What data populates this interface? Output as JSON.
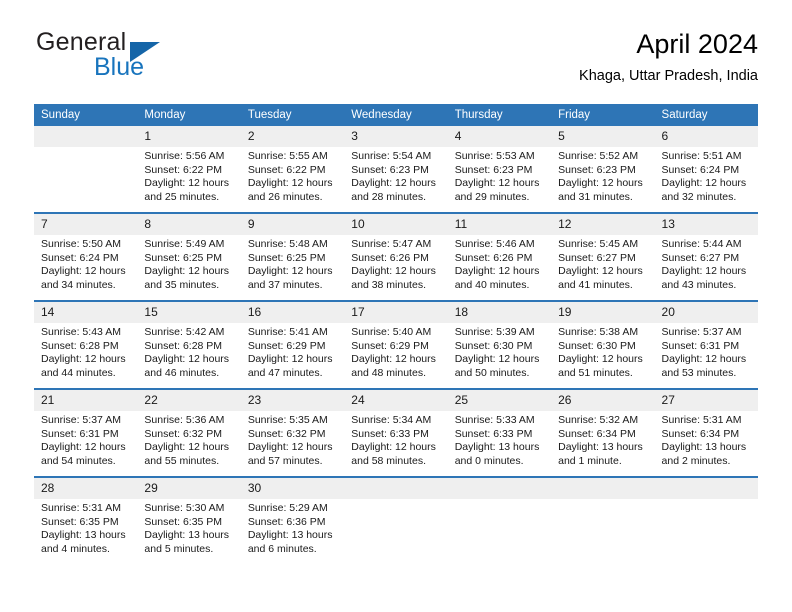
{
  "logo": {
    "word_top": "General",
    "word_bottom": "Blue",
    "triangle_color": "#1565a8",
    "blue_color": "#1874bd"
  },
  "header": {
    "title": "April 2024",
    "subtitle": "Khaga, Uttar Pradesh, India"
  },
  "theme": {
    "header_blue": "#2e75b6",
    "daynum_gray": "#efefef"
  },
  "weekday_headers": [
    "Sunday",
    "Monday",
    "Tuesday",
    "Wednesday",
    "Thursday",
    "Friday",
    "Saturday"
  ],
  "labels": {
    "sunrise": "Sunrise:",
    "sunset": "Sunset:",
    "daylight": "Daylight:"
  },
  "weeks": [
    [
      {
        "day": "",
        "sunrise": "",
        "sunset": "",
        "daylight1": "",
        "daylight2": ""
      },
      {
        "day": "1",
        "sunrise": "Sunrise: 5:56 AM",
        "sunset": "Sunset: 6:22 PM",
        "daylight1": "Daylight: 12 hours",
        "daylight2": "and 25 minutes."
      },
      {
        "day": "2",
        "sunrise": "Sunrise: 5:55 AM",
        "sunset": "Sunset: 6:22 PM",
        "daylight1": "Daylight: 12 hours",
        "daylight2": "and 26 minutes."
      },
      {
        "day": "3",
        "sunrise": "Sunrise: 5:54 AM",
        "sunset": "Sunset: 6:23 PM",
        "daylight1": "Daylight: 12 hours",
        "daylight2": "and 28 minutes."
      },
      {
        "day": "4",
        "sunrise": "Sunrise: 5:53 AM",
        "sunset": "Sunset: 6:23 PM",
        "daylight1": "Daylight: 12 hours",
        "daylight2": "and 29 minutes."
      },
      {
        "day": "5",
        "sunrise": "Sunrise: 5:52 AM",
        "sunset": "Sunset: 6:23 PM",
        "daylight1": "Daylight: 12 hours",
        "daylight2": "and 31 minutes."
      },
      {
        "day": "6",
        "sunrise": "Sunrise: 5:51 AM",
        "sunset": "Sunset: 6:24 PM",
        "daylight1": "Daylight: 12 hours",
        "daylight2": "and 32 minutes."
      }
    ],
    [
      {
        "day": "7",
        "sunrise": "Sunrise: 5:50 AM",
        "sunset": "Sunset: 6:24 PM",
        "daylight1": "Daylight: 12 hours",
        "daylight2": "and 34 minutes."
      },
      {
        "day": "8",
        "sunrise": "Sunrise: 5:49 AM",
        "sunset": "Sunset: 6:25 PM",
        "daylight1": "Daylight: 12 hours",
        "daylight2": "and 35 minutes."
      },
      {
        "day": "9",
        "sunrise": "Sunrise: 5:48 AM",
        "sunset": "Sunset: 6:25 PM",
        "daylight1": "Daylight: 12 hours",
        "daylight2": "and 37 minutes."
      },
      {
        "day": "10",
        "sunrise": "Sunrise: 5:47 AM",
        "sunset": "Sunset: 6:26 PM",
        "daylight1": "Daylight: 12 hours",
        "daylight2": "and 38 minutes."
      },
      {
        "day": "11",
        "sunrise": "Sunrise: 5:46 AM",
        "sunset": "Sunset: 6:26 PM",
        "daylight1": "Daylight: 12 hours",
        "daylight2": "and 40 minutes."
      },
      {
        "day": "12",
        "sunrise": "Sunrise: 5:45 AM",
        "sunset": "Sunset: 6:27 PM",
        "daylight1": "Daylight: 12 hours",
        "daylight2": "and 41 minutes."
      },
      {
        "day": "13",
        "sunrise": "Sunrise: 5:44 AM",
        "sunset": "Sunset: 6:27 PM",
        "daylight1": "Daylight: 12 hours",
        "daylight2": "and 43 minutes."
      }
    ],
    [
      {
        "day": "14",
        "sunrise": "Sunrise: 5:43 AM",
        "sunset": "Sunset: 6:28 PM",
        "daylight1": "Daylight: 12 hours",
        "daylight2": "and 44 minutes."
      },
      {
        "day": "15",
        "sunrise": "Sunrise: 5:42 AM",
        "sunset": "Sunset: 6:28 PM",
        "daylight1": "Daylight: 12 hours",
        "daylight2": "and 46 minutes."
      },
      {
        "day": "16",
        "sunrise": "Sunrise: 5:41 AM",
        "sunset": "Sunset: 6:29 PM",
        "daylight1": "Daylight: 12 hours",
        "daylight2": "and 47 minutes."
      },
      {
        "day": "17",
        "sunrise": "Sunrise: 5:40 AM",
        "sunset": "Sunset: 6:29 PM",
        "daylight1": "Daylight: 12 hours",
        "daylight2": "and 48 minutes."
      },
      {
        "day": "18",
        "sunrise": "Sunrise: 5:39 AM",
        "sunset": "Sunset: 6:30 PM",
        "daylight1": "Daylight: 12 hours",
        "daylight2": "and 50 minutes."
      },
      {
        "day": "19",
        "sunrise": "Sunrise: 5:38 AM",
        "sunset": "Sunset: 6:30 PM",
        "daylight1": "Daylight: 12 hours",
        "daylight2": "and 51 minutes."
      },
      {
        "day": "20",
        "sunrise": "Sunrise: 5:37 AM",
        "sunset": "Sunset: 6:31 PM",
        "daylight1": "Daylight: 12 hours",
        "daylight2": "and 53 minutes."
      }
    ],
    [
      {
        "day": "21",
        "sunrise": "Sunrise: 5:37 AM",
        "sunset": "Sunset: 6:31 PM",
        "daylight1": "Daylight: 12 hours",
        "daylight2": "and 54 minutes."
      },
      {
        "day": "22",
        "sunrise": "Sunrise: 5:36 AM",
        "sunset": "Sunset: 6:32 PM",
        "daylight1": "Daylight: 12 hours",
        "daylight2": "and 55 minutes."
      },
      {
        "day": "23",
        "sunrise": "Sunrise: 5:35 AM",
        "sunset": "Sunset: 6:32 PM",
        "daylight1": "Daylight: 12 hours",
        "daylight2": "and 57 minutes."
      },
      {
        "day": "24",
        "sunrise": "Sunrise: 5:34 AM",
        "sunset": "Sunset: 6:33 PM",
        "daylight1": "Daylight: 12 hours",
        "daylight2": "and 58 minutes."
      },
      {
        "day": "25",
        "sunrise": "Sunrise: 5:33 AM",
        "sunset": "Sunset: 6:33 PM",
        "daylight1": "Daylight: 13 hours",
        "daylight2": "and 0 minutes."
      },
      {
        "day": "26",
        "sunrise": "Sunrise: 5:32 AM",
        "sunset": "Sunset: 6:34 PM",
        "daylight1": "Daylight: 13 hours",
        "daylight2": "and 1 minute."
      },
      {
        "day": "27",
        "sunrise": "Sunrise: 5:31 AM",
        "sunset": "Sunset: 6:34 PM",
        "daylight1": "Daylight: 13 hours",
        "daylight2": "and 2 minutes."
      }
    ],
    [
      {
        "day": "28",
        "sunrise": "Sunrise: 5:31 AM",
        "sunset": "Sunset: 6:35 PM",
        "daylight1": "Daylight: 13 hours",
        "daylight2": "and 4 minutes."
      },
      {
        "day": "29",
        "sunrise": "Sunrise: 5:30 AM",
        "sunset": "Sunset: 6:35 PM",
        "daylight1": "Daylight: 13 hours",
        "daylight2": "and 5 minutes."
      },
      {
        "day": "30",
        "sunrise": "Sunrise: 5:29 AM",
        "sunset": "Sunset: 6:36 PM",
        "daylight1": "Daylight: 13 hours",
        "daylight2": "and 6 minutes."
      },
      {
        "day": "",
        "sunrise": "",
        "sunset": "",
        "daylight1": "",
        "daylight2": ""
      },
      {
        "day": "",
        "sunrise": "",
        "sunset": "",
        "daylight1": "",
        "daylight2": ""
      },
      {
        "day": "",
        "sunrise": "",
        "sunset": "",
        "daylight1": "",
        "daylight2": ""
      },
      {
        "day": "",
        "sunrise": "",
        "sunset": "",
        "daylight1": "",
        "daylight2": ""
      }
    ]
  ]
}
